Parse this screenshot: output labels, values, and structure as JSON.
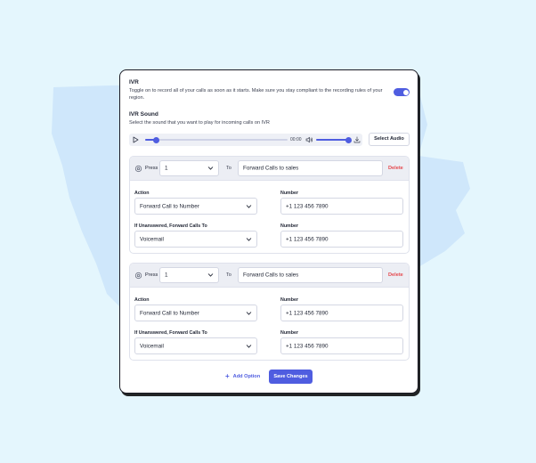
{
  "ivr": {
    "title": "IVR",
    "description": "Toggle on to record all of your calls as soon as it starts. Make sure you stay compliant to the recording rules of your region.",
    "enabled": true
  },
  "ivr_sound": {
    "title": "IVR Sound",
    "description": "Select the sound that you want to play for incoming calls on IVR",
    "time": "00:00",
    "progress": 0.08,
    "volume": 0.9,
    "select_audio_label": "Select Audio"
  },
  "options": [
    {
      "press_label": "Press",
      "press_value": "1",
      "to_label": "To",
      "destination": "Forward Calls to sales",
      "delete_label": "Delete",
      "action_label": "Action",
      "action_value": "Forward Call to Number",
      "number_label": "Number",
      "number_value": "+1 123 456 7890",
      "unanswered_label": "If Unanswered, Forward Calls To",
      "unanswered_value": "Voicemail",
      "number2_label": "Number",
      "number2_value": "+1 123 456 7890"
    },
    {
      "press_label": "Press",
      "press_value": "1",
      "to_label": "To",
      "destination": "Forward Calls to sales",
      "delete_label": "Delete",
      "action_label": "Action",
      "action_value": "Forward Call to Number",
      "number_label": "Number",
      "number_value": "+1 123 456 7890",
      "unanswered_label": "If Unanswered, Forward Calls To",
      "unanswered_value": "Voicemail",
      "number2_label": "Number",
      "number2_value": "+1 123 456 7890"
    }
  ],
  "footer": {
    "add_option_label": "Add Option",
    "save_label": "Save Changes"
  },
  "colors": {
    "accent": "#4f5de0",
    "danger": "#e5484d",
    "background": "#e4f6fd"
  }
}
